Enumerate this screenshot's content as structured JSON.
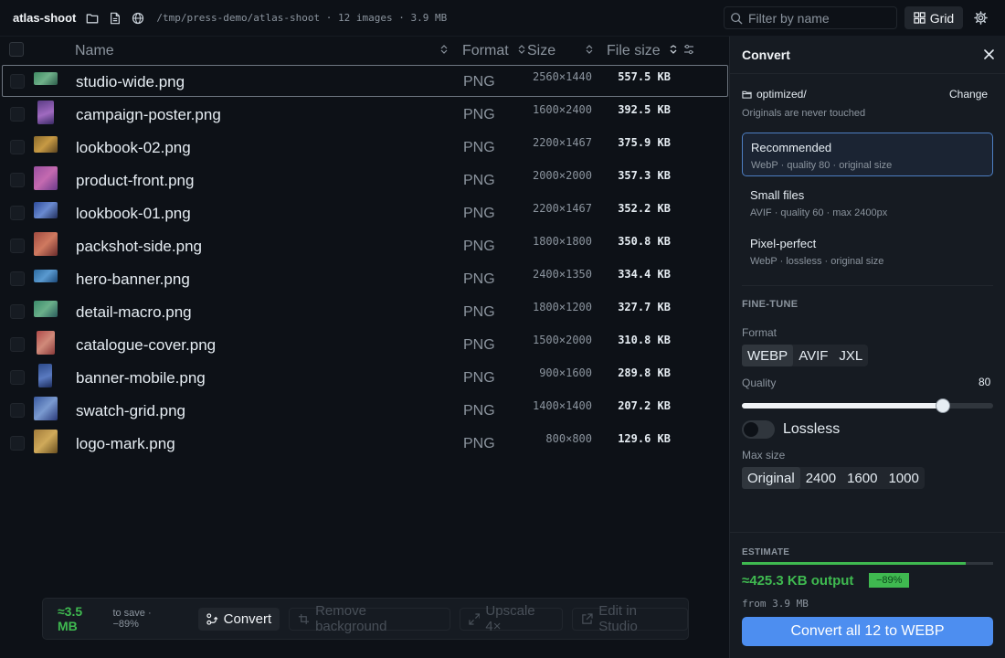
{
  "app": {
    "title": "atlas-shoot",
    "path_info": "/tmp/press-demo/atlas-shoot · 12 images · 3.9 MB"
  },
  "toolbar": {
    "icons": [
      "folder-icon",
      "file-icon",
      "globe-icon"
    ],
    "filter_placeholder": "Filter by name",
    "view_label": "Grid",
    "settings_icon": "gear-icon"
  },
  "table": {
    "headers": {
      "name": "Name",
      "format": "Format",
      "size": "Size",
      "file_size": "File size"
    },
    "rows": [
      {
        "name": "studio-wide.png",
        "format": "PNG",
        "dims": "2560×1440",
        "file_size": "557.5 KB",
        "selected": true
      },
      {
        "name": "campaign-poster.png",
        "format": "PNG",
        "dims": "1600×2400",
        "file_size": "392.5 KB"
      },
      {
        "name": "lookbook-02.png",
        "format": "PNG",
        "dims": "2200×1467",
        "file_size": "375.9 KB"
      },
      {
        "name": "product-front.png",
        "format": "PNG",
        "dims": "2000×2000",
        "file_size": "357.3 KB"
      },
      {
        "name": "lookbook-01.png",
        "format": "PNG",
        "dims": "2200×1467",
        "file_size": "352.2 KB"
      },
      {
        "name": "packshot-side.png",
        "format": "PNG",
        "dims": "1800×1800",
        "file_size": "350.8 KB"
      },
      {
        "name": "hero-banner.png",
        "format": "PNG",
        "dims": "2400×1350",
        "file_size": "334.4 KB"
      },
      {
        "name": "detail-macro.png",
        "format": "PNG",
        "dims": "1800×1200",
        "file_size": "327.7 KB"
      },
      {
        "name": "catalogue-cover.png",
        "format": "PNG",
        "dims": "1500×2000",
        "file_size": "310.8 KB"
      },
      {
        "name": "banner-mobile.png",
        "format": "PNG",
        "dims": "900×1600",
        "file_size": "289.8 KB"
      },
      {
        "name": "swatch-grid.png",
        "format": "PNG",
        "dims": "1400×1400",
        "file_size": "207.2 KB"
      },
      {
        "name": "logo-mark.png",
        "format": "PNG",
        "dims": "800×800",
        "file_size": "129.6 KB"
      }
    ]
  },
  "action_bar": {
    "savings": "≈3.5 MB",
    "savings_note": "to save · −89%",
    "convert_label": "Convert",
    "remove_bg_label": "Remove background",
    "upscale_label": "Upscale 4×",
    "studio_label": "Edit in Studio"
  },
  "panel": {
    "title": "Convert",
    "output_folder": "optimized/",
    "change_label": "Change",
    "originals_note": "Originals are never touched",
    "presets": [
      {
        "title": "Recommended",
        "subtitle": "WebP · quality 80 · original size",
        "active": true
      },
      {
        "title": "Small files",
        "subtitle": "AVIF · quality 60 · max 2400px"
      },
      {
        "title": "Pixel-perfect",
        "subtitle": "WebP · lossless · original size"
      }
    ],
    "finetune_label": "FINE-TUNE",
    "format_label": "Format",
    "formats": [
      "WEBP",
      "AVIF",
      "JXL"
    ],
    "format_selected": "WEBP",
    "quality_label": "Quality",
    "quality_value": "80",
    "quality_fraction": 0.8,
    "lossless_label": "Lossless",
    "lossless_on": false,
    "maxsize_label": "Max size",
    "max_sizes": [
      "Original",
      "2400",
      "1600",
      "1000"
    ],
    "max_size_selected": "Original",
    "estimate_label": "ESTIMATE",
    "estimate_output": "≈425.3 KB output",
    "estimate_badge": "−89%",
    "estimate_from": "from 3.9 MB",
    "estimate_fraction": 0.89,
    "convert_all_label": "Convert all 12 to WEBP"
  },
  "colors": {
    "accent": "#4d8ef0",
    "success": "#3fb950",
    "background": "#0d1117",
    "panel": "#161b22"
  }
}
